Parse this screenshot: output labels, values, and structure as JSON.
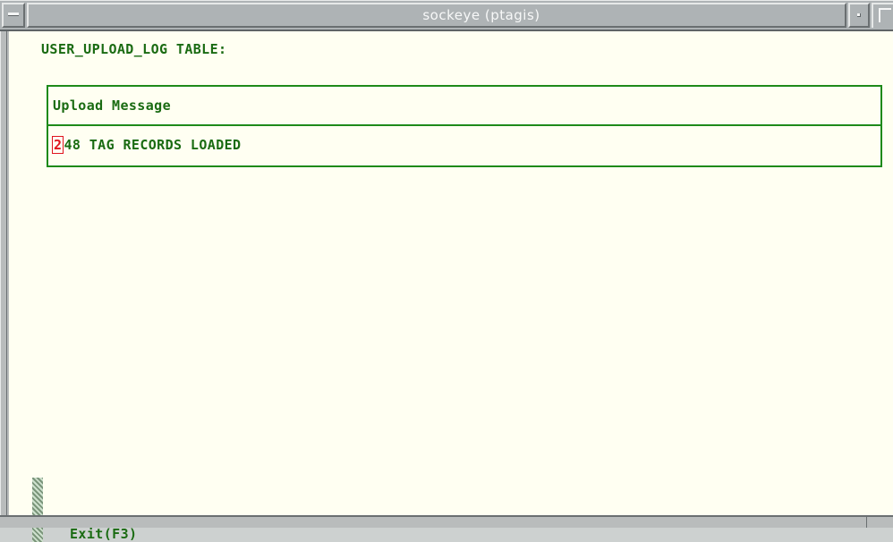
{
  "window": {
    "title": "sockeye (ptagis)"
  },
  "terminal": {
    "heading": "USER_UPLOAD_LOG TABLE:",
    "table": {
      "column_header": "Upload Message",
      "rows": [
        {
          "cursor_char": "2",
          "rest": "48 TAG RECORDS LOADED"
        }
      ]
    },
    "footer": {
      "exit_label": "Exit(F3)"
    }
  },
  "colors": {
    "text_green": "#1a6b12",
    "table_border": "#1e8a1a",
    "background": "#fffff2",
    "cursor_red": "#e0141e",
    "chrome_gray": "#b9bcbc"
  },
  "icons": {
    "window_menu": "window-menu-icon",
    "minimize": "minimize-icon",
    "maximize": "maximize-icon"
  }
}
